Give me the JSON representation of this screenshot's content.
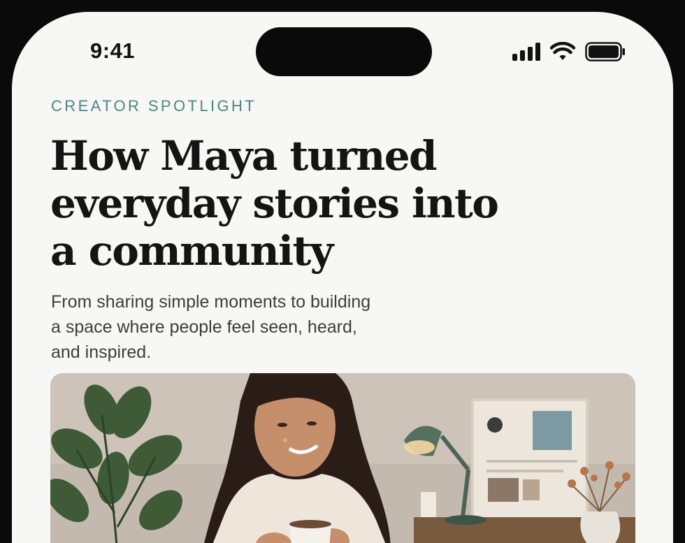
{
  "status_bar": {
    "time": "9:41",
    "icons": [
      "cellular-signal-icon",
      "wifi-icon",
      "battery-icon"
    ]
  },
  "article": {
    "eyebrow": "CREATOR SPOTLIGHT",
    "headline_lines": [
      "How Maya turned",
      "everyday stories into",
      "a community"
    ],
    "dek_lines": [
      "From sharing simple moments to building",
      "a space where people feel seen, heard,",
      "and inspired."
    ]
  },
  "colors": {
    "eyebrow": "#4e8585",
    "headline": "#141414",
    "background": "#f7f7f6"
  }
}
